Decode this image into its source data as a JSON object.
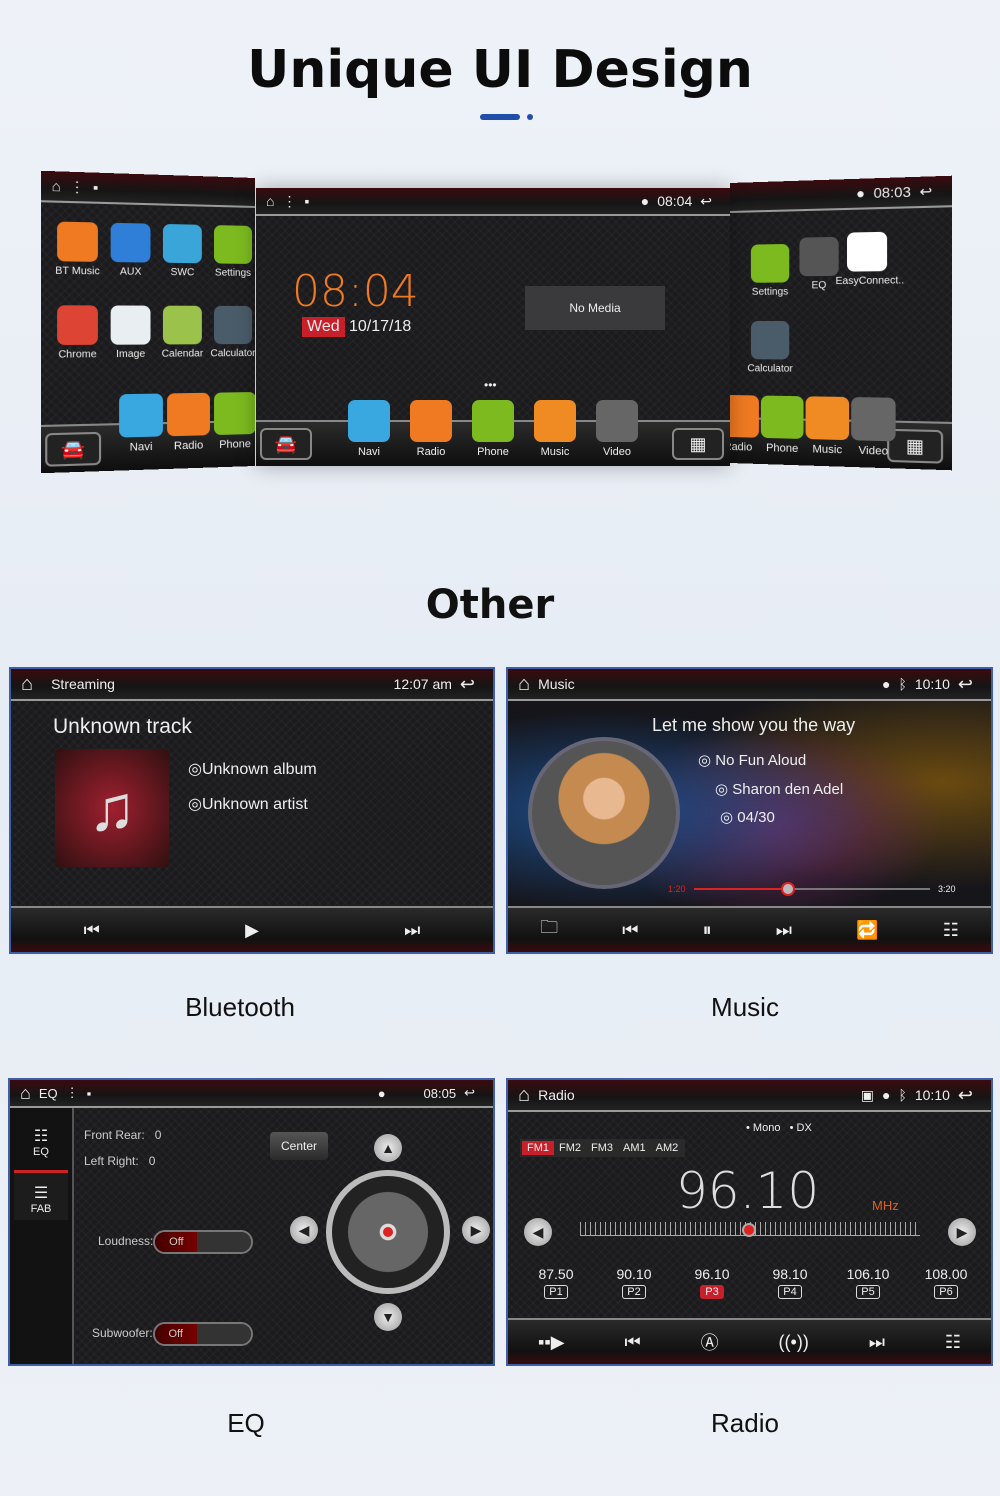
{
  "title": "Unique UI Design",
  "subtitle": "Other",
  "accent": "#1f4fa8",
  "home_left": {
    "apps": [
      {
        "label": "BT Music",
        "color": "#f07a22",
        "icon": "bluetooth-music-icon"
      },
      {
        "label": "AUX",
        "color": "#2f7fd8",
        "icon": "aux-icon"
      },
      {
        "label": "SWC",
        "color": "#3aa5d8",
        "icon": "steering-wheel-icon"
      },
      {
        "label": "Settings",
        "color": "#7cba1f",
        "icon": "gear-icon"
      },
      {
        "label": "Chrome",
        "color": "#dd4433",
        "icon": "chrome-icon"
      },
      {
        "label": "Image",
        "color": "#e8eef2",
        "icon": "image-icon"
      },
      {
        "label": "Calendar",
        "color": "#9bc24a",
        "icon": "calendar-icon"
      },
      {
        "label": "Calculator",
        "color": "#4a5b6a",
        "icon": "calculator-icon"
      }
    ],
    "dock": [
      {
        "label": "Navi",
        "color": "#39a8e0"
      },
      {
        "label": "Radio",
        "color": "#f07a22"
      },
      {
        "label": "Phone",
        "color": "#7cba1f"
      }
    ]
  },
  "home_center": {
    "status_time": "08:04",
    "clock": "08:04",
    "day": "Wed",
    "date": "10/17/18",
    "no_media": "No Media",
    "dock": [
      {
        "label": "Navi",
        "color": "#39a8e0"
      },
      {
        "label": "Radio",
        "color": "#f07a22"
      },
      {
        "label": "Phone",
        "color": "#7cba1f"
      },
      {
        "label": "Music",
        "color": "#f08a22"
      },
      {
        "label": "Video",
        "color": "#666"
      }
    ]
  },
  "home_right": {
    "status_time": "08:03",
    "apps": [
      {
        "label": "Settings",
        "color": "#7cba1f"
      },
      {
        "label": "EQ",
        "color": "#555"
      },
      {
        "label": "EasyConnect..",
        "color": "#ffffff"
      },
      {
        "label": "Calculator",
        "color": "#4a5b6a"
      }
    ],
    "dock": [
      {
        "label": "Radio",
        "color": "#f07a22"
      },
      {
        "label": "Phone",
        "color": "#7cba1f"
      },
      {
        "label": "Music",
        "color": "#f08a22"
      },
      {
        "label": "Video",
        "color": "#666"
      }
    ]
  },
  "bluetooth": {
    "header": "Streaming",
    "time": "12:07 am",
    "track": "Unknown track",
    "album": "Unknown album",
    "artist": "Unknown artist",
    "caption": "Bluetooth"
  },
  "music": {
    "header": "Music",
    "time": "10:10",
    "title": "Let me show you the way",
    "album": "No Fun Aloud",
    "artist": "Sharon den Adel",
    "track": "04/30",
    "elapsed": "1:20",
    "total": "3:20",
    "progress": 0.4,
    "caption": "Music"
  },
  "eq": {
    "header": "EQ",
    "time": "08:05",
    "tabs": [
      {
        "label": "EQ"
      },
      {
        "label": "FAB"
      }
    ],
    "front_rear_label": "Front Rear:",
    "front_rear": "0",
    "left_right_label": "Left Right:",
    "left_right": "0",
    "center": "Center",
    "loudness_label": "Loudness:",
    "loudness": "Off",
    "subwoofer_label": "Subwoofer:",
    "subwoofer": "Off",
    "caption": "EQ"
  },
  "radio": {
    "header": "Radio",
    "time": "10:10",
    "mono": "Mono",
    "dx": "DX",
    "bands": [
      "FM1",
      "FM2",
      "FM3",
      "AM1",
      "AM2"
    ],
    "active_band": "FM1",
    "frequency": "96.10",
    "unit": "MHz",
    "presets": [
      {
        "freq": "87.50",
        "label": "P1"
      },
      {
        "freq": "90.10",
        "label": "P2"
      },
      {
        "freq": "96.10",
        "label": "P3",
        "active": true
      },
      {
        "freq": "98.10",
        "label": "P4"
      },
      {
        "freq": "106.10",
        "label": "P5"
      },
      {
        "freq": "108.00",
        "label": "P6"
      }
    ],
    "caption": "Radio"
  }
}
